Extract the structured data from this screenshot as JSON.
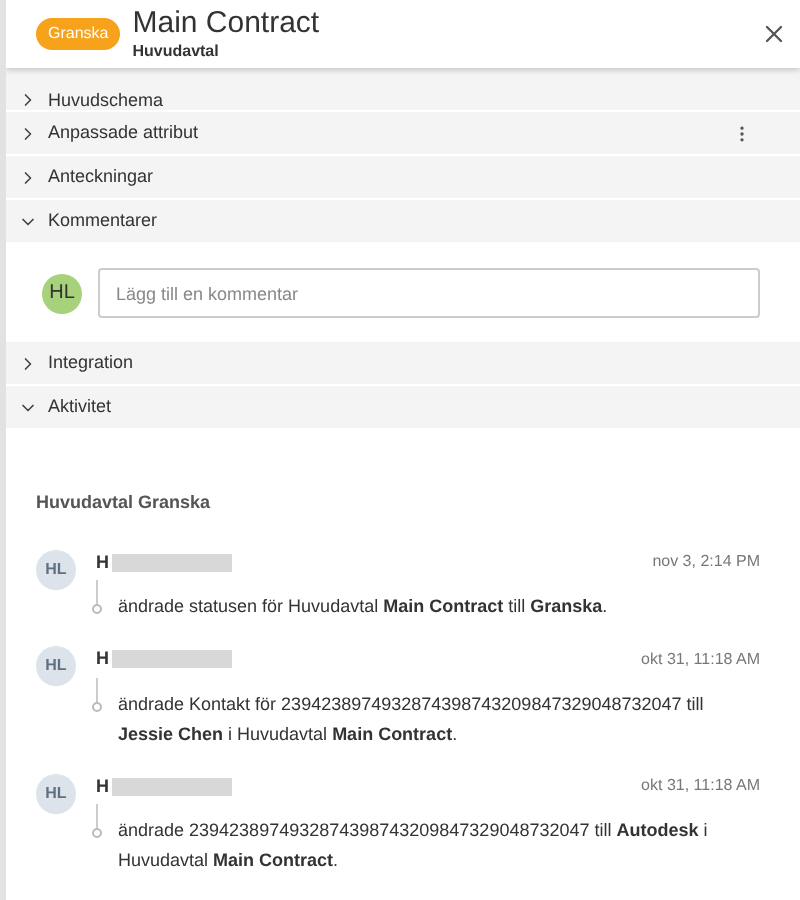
{
  "header": {
    "status": "Granska",
    "title": "Main Contract",
    "subtitle": "Huvudavtal"
  },
  "sections": [
    {
      "label": "Huvudschema",
      "expanded": false,
      "menu": false
    },
    {
      "label": "Anpassade attribut",
      "expanded": false,
      "menu": true
    },
    {
      "label": "Anteckningar",
      "expanded": false,
      "menu": false
    },
    {
      "label": "Kommentarer",
      "expanded": true,
      "menu": false,
      "comment": {
        "avatar": "HL",
        "placeholder": "Lägg till en kommentar"
      }
    },
    {
      "label": "Integration",
      "expanded": false,
      "menu": false
    },
    {
      "label": "Aktivitet",
      "expanded": true,
      "menu": false
    }
  ],
  "activity": {
    "heading": "Huvudavtal Granska",
    "entries": [
      {
        "avatar": "HL",
        "name": "H",
        "time": "nov 3, 2:14 PM",
        "text": "ändrade statusen för Huvudavtal **Main Contract** till **Granska**."
      },
      {
        "avatar": "HL",
        "name": "H",
        "time": "okt 31, 11:18 AM",
        "text": "ändrade Kontakt för 2394238974932874398743209847329048732047 till **Jessie Chen** i Huvudavtal **Main Contract**."
      },
      {
        "avatar": "HL",
        "name": "H",
        "time": "okt 31, 11:18 AM",
        "text": "ändrade 2394238974932874398743209847329048732047 till **Autodesk** i Huvudavtal **Main Contract**."
      }
    ]
  }
}
